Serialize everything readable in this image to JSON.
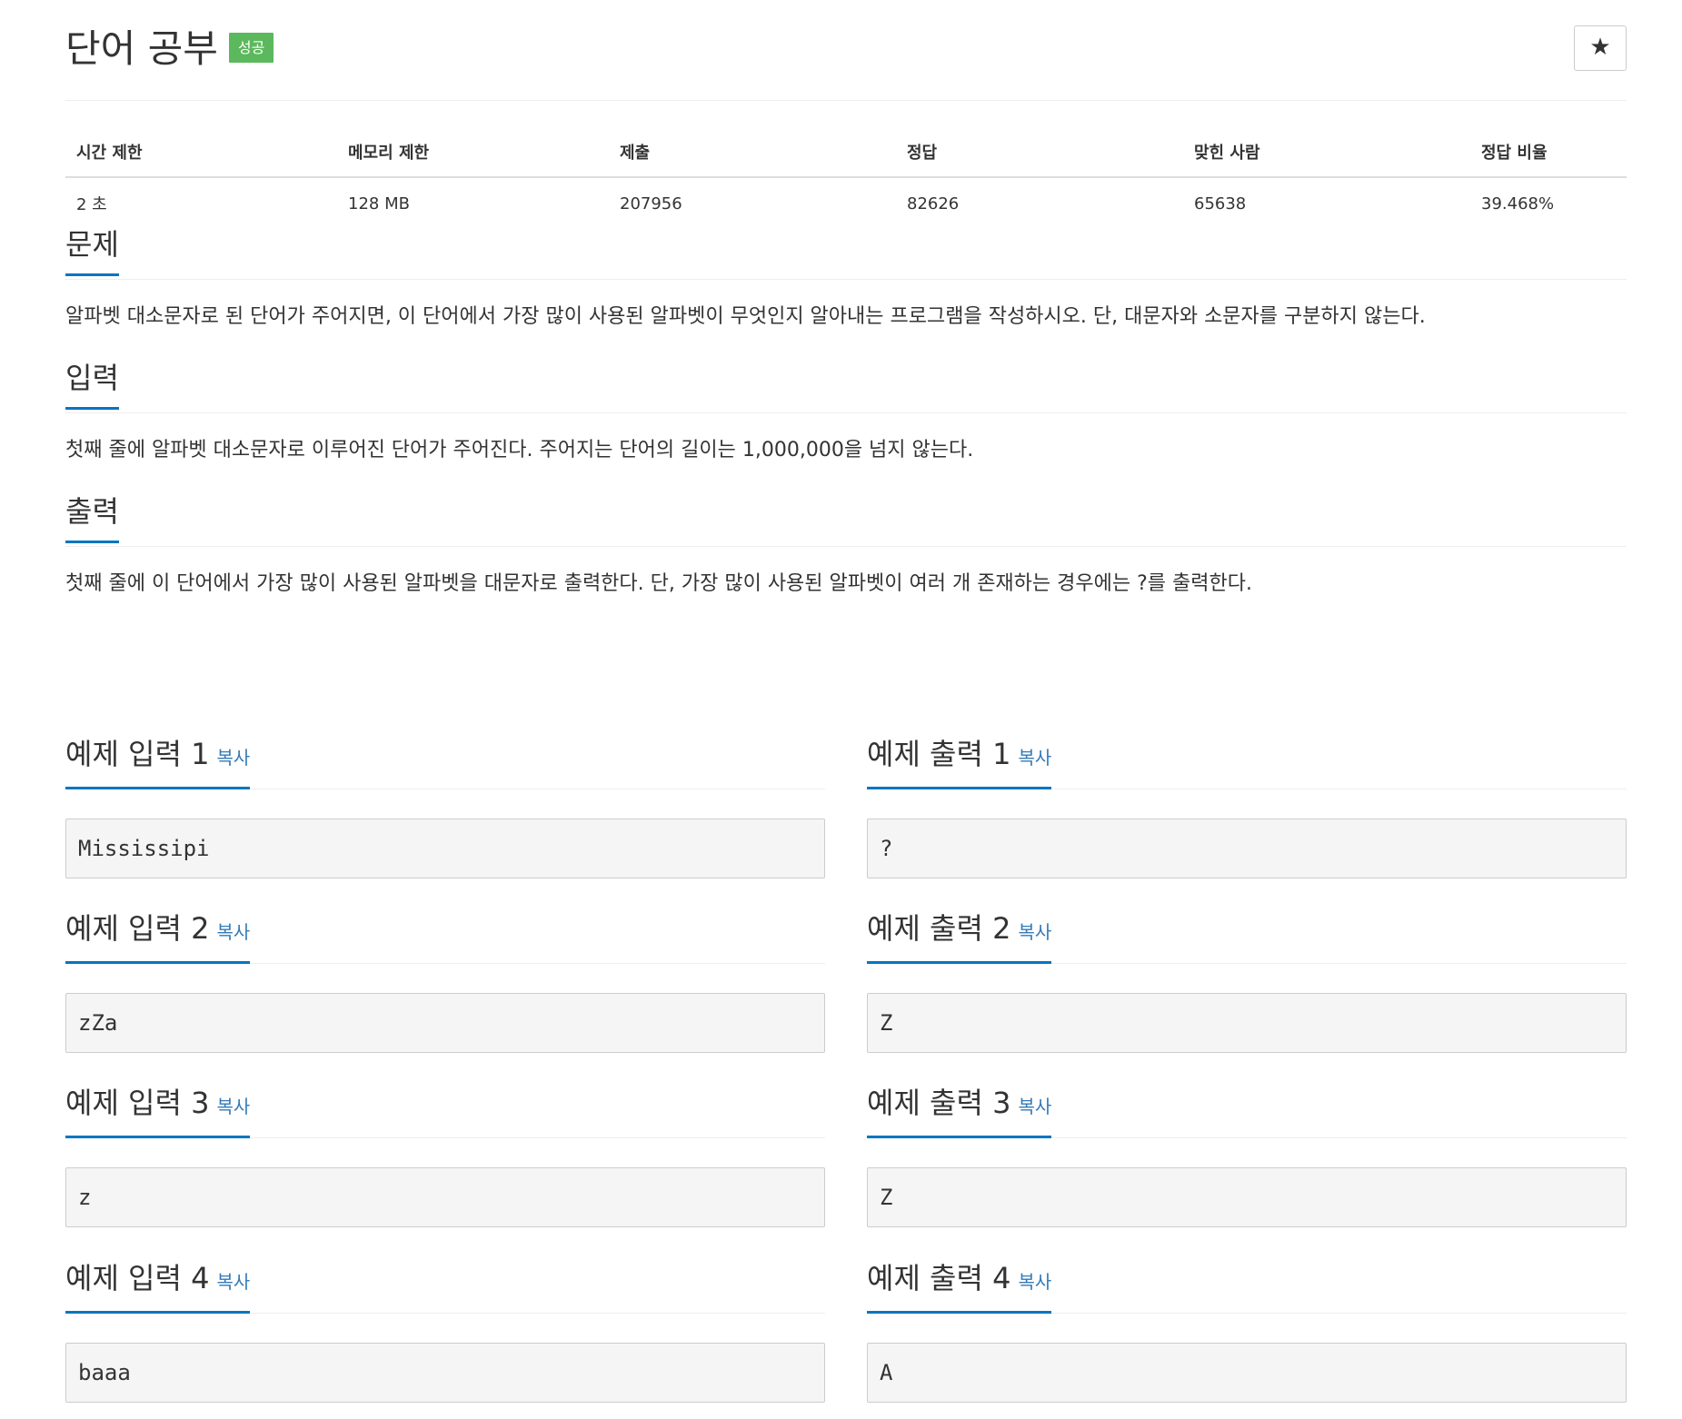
{
  "header": {
    "title": "단어 공부",
    "result_badge": "성공",
    "star_icon": "★"
  },
  "info_table": {
    "headers": [
      "시간 제한",
      "메모리 제한",
      "제출",
      "정답",
      "맞힌 사람",
      "정답 비율"
    ],
    "values": [
      "2 초",
      "128 MB",
      "207956",
      "82626",
      "65638",
      "39.468%"
    ]
  },
  "sections": {
    "problem": {
      "title": "문제",
      "text": "알파벳 대소문자로 된 단어가 주어지면, 이 단어에서 가장 많이 사용된 알파벳이 무엇인지 알아내는 프로그램을 작성하시오. 단, 대문자와 소문자를 구분하지 않는다."
    },
    "input": {
      "title": "입력",
      "text": "첫째 줄에 알파벳 대소문자로 이루어진 단어가 주어진다. 주어지는 단어의 길이는 1,000,000을 넘지 않는다."
    },
    "output": {
      "title": "출력",
      "text": "첫째 줄에 이 단어에서 가장 많이 사용된 알파벳을 대문자로 출력한다. 단, 가장 많이 사용된 알파벳이 여러 개 존재하는 경우에는 ?를 출력한다."
    }
  },
  "copy_label": "복사",
  "samples": [
    {
      "input_title": "예제 입력 1",
      "input": "Mississipi",
      "output_title": "예제 출력 1",
      "output": "?"
    },
    {
      "input_title": "예제 입력 2",
      "input": "zZa",
      "output_title": "예제 출력 2",
      "output": "Z"
    },
    {
      "input_title": "예제 입력 3",
      "input": "z",
      "output_title": "예제 출력 3",
      "output": "Z"
    },
    {
      "input_title": "예제 입력 4",
      "input": "baaa",
      "output_title": "예제 출력 4",
      "output": "A"
    }
  ]
}
